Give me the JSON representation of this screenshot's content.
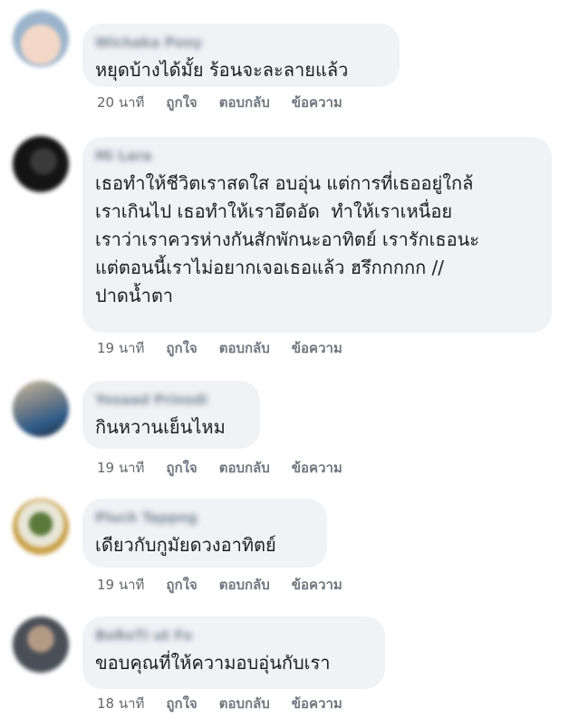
{
  "comments": [
    {
      "author": "Wichaka Pooy",
      "text": "หยุดบ้างได้มั้ย ร้อนจะละลายแล้ว",
      "time": "20 นาที",
      "like": "ถูกใจ",
      "reply": "ตอบกลับ",
      "message": "ข้อความ"
    },
    {
      "author": "Mi Lara",
      "text": "เธอทำให้ชีวิตเราสดใส อบอุ่น แต่การที่เธออยู่ใกล้\nเราเกินไป เธอทำให้เราอึดอัด  ทำให้เราเหนื่อย\nเราว่าเราควรห่างกันสักพักนะอาทิตย์ เรารักเธอนะ\nแต่ตอนนี้เราไม่อยากเจอเธอแล้ว ฮรึกกกกก //\nปาดน้ำตา",
      "time": "19 นาที",
      "like": "ถูกใจ",
      "reply": "ตอบกลับ",
      "message": "ข้อความ"
    },
    {
      "author": "Yosaad Prinsdi",
      "text": "กินหวานเย็นไหม",
      "time": "19 นาที",
      "like": "ถูกใจ",
      "reply": "ตอบกลับ",
      "message": "ข้อความ"
    },
    {
      "author": "Pluch Tappng",
      "text": "เดียวกับกูมัยดวงอาทิตย์",
      "time": "19 นาที",
      "like": "ถูกใจ",
      "reply": "ตอบกลับ",
      "message": "ข้อความ"
    },
    {
      "author": "BoRoTi ut Fo",
      "text": "ขอบคุณที่ให้ความอบอุ่นกับเรา",
      "time": "18 นาที",
      "like": "ถูกใจ",
      "reply": "ตอบกลับ",
      "message": "ข้อความ"
    }
  ]
}
